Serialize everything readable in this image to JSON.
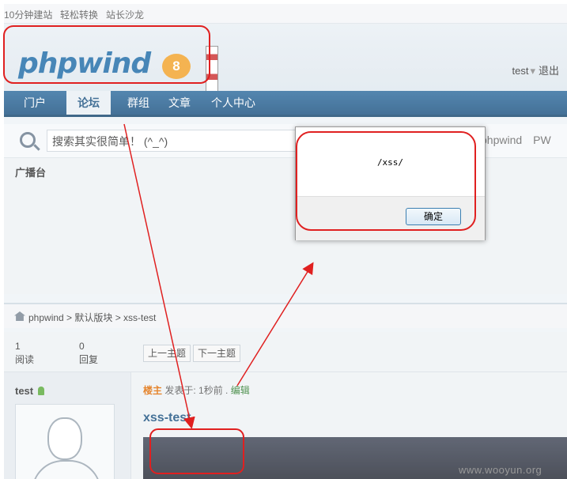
{
  "topbar": {
    "links": [
      "10分钟建站",
      "轻松转换",
      "站长沙龙"
    ]
  },
  "header": {
    "logo_text": "phpwind",
    "logo_badge": "8",
    "user": "test",
    "user_arrow": "▾",
    "logout": "退出"
  },
  "nav": {
    "items": [
      "门户",
      "论坛",
      "群组",
      "文章",
      "个人中心"
    ],
    "active": "论坛"
  },
  "search": {
    "placeholder": "搜索其实很简单！ (^_^)",
    "links": [
      "phpwind",
      "PW"
    ]
  },
  "broadcast": {
    "title": "广播台"
  },
  "breadcrumb": {
    "path": "phpwind > 默认版块 > xss-test"
  },
  "stats": {
    "views_value": "1",
    "views_label": "阅读",
    "replies_value": "0",
    "replies_label": "回复",
    "prev": "上一主题",
    "next": "下一主题"
  },
  "post": {
    "author": "test",
    "louzhu": "楼主",
    "posted": "发表于: 1秒前 .",
    "edit": "编辑",
    "title": "xss-test"
  },
  "dialog": {
    "message": "/xss/",
    "ok_label": "确定"
  },
  "colors": {
    "nav_bg": "#1c5281",
    "annotation_red": "#e02020",
    "accent_orange": "#e06b00"
  },
  "watermark": "www.wooyun.org"
}
